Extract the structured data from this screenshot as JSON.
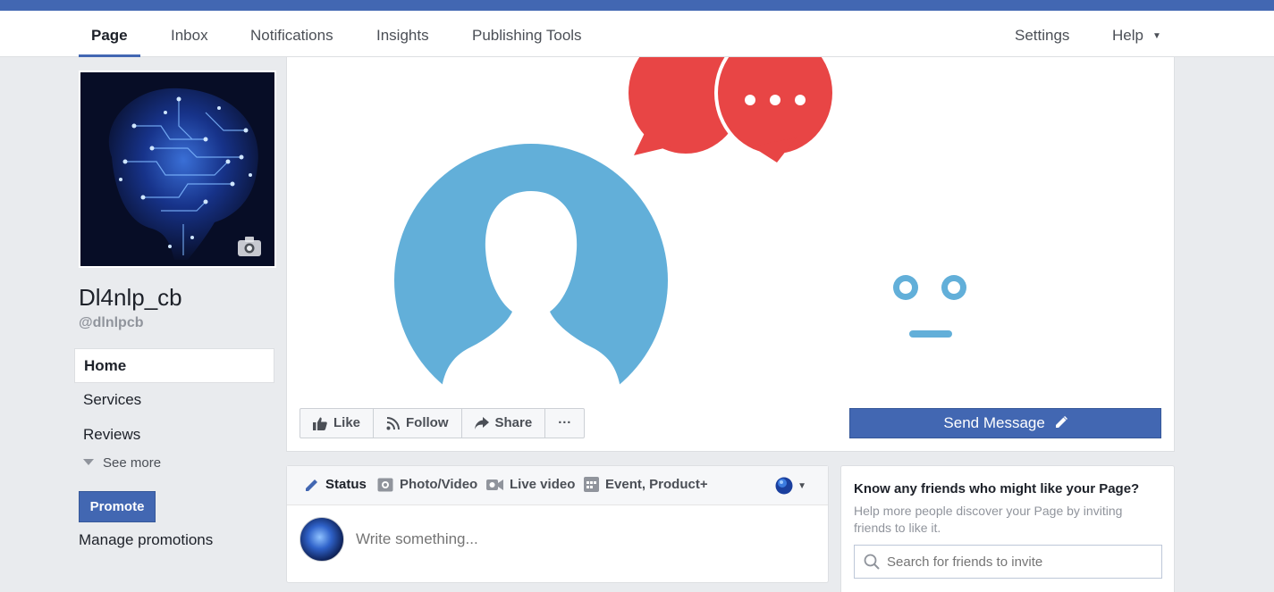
{
  "nav": {
    "tabs": [
      {
        "label": "Page"
      },
      {
        "label": "Inbox"
      },
      {
        "label": "Notifications"
      },
      {
        "label": "Insights"
      },
      {
        "label": "Publishing Tools"
      }
    ],
    "settings": "Settings",
    "help": "Help"
  },
  "page": {
    "name": "Dl4nlp_cb",
    "handle": "@dlnlpcb"
  },
  "left_menu": {
    "items": [
      {
        "label": "Home"
      },
      {
        "label": "Services"
      },
      {
        "label": "Reviews"
      }
    ],
    "see_more": "See more",
    "promote": "Promote",
    "manage_promotions": "Manage promotions"
  },
  "actions": {
    "like": "Like",
    "follow": "Follow",
    "share": "Share",
    "more": "···",
    "send_message": "Send Message"
  },
  "composer": {
    "tabs": [
      {
        "label": "Status"
      },
      {
        "label": "Photo/Video"
      },
      {
        "label": "Live video"
      },
      {
        "label": "Event, Product+"
      }
    ],
    "placeholder": "Write something..."
  },
  "invite": {
    "title": "Know any friends who might like your Page?",
    "description": "Help more people discover your Page by inviting friends to like it.",
    "search_placeholder": "Search for friends to invite"
  },
  "colors": {
    "brand": "#4267b2",
    "bubble": "#e84545",
    "avatar_blue": "#62afd9"
  },
  "icons": [
    "camera-icon",
    "like-icon",
    "rss-icon",
    "share-icon",
    "pencil-icon",
    "status-icon",
    "photo-icon",
    "video-camera-icon",
    "event-icon",
    "globe-icon",
    "search-icon"
  ]
}
